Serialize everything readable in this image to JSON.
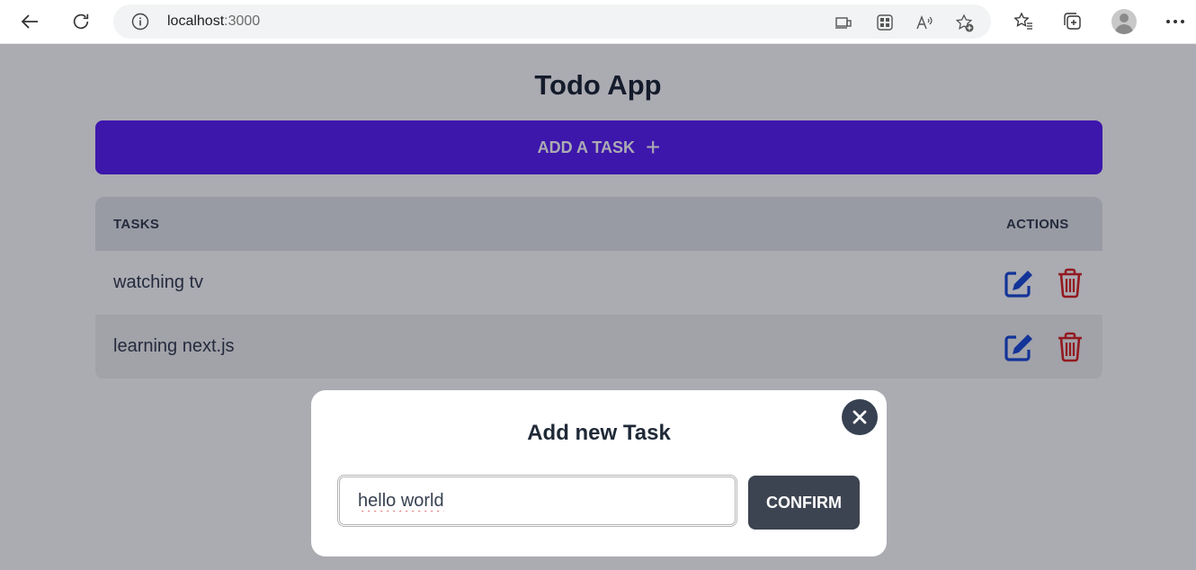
{
  "browser": {
    "url_host": "localhost",
    "url_port": ":3000",
    "icons": [
      "back-icon",
      "refresh-icon",
      "info-icon",
      "device-icon",
      "apps-icon",
      "read-aloud-icon",
      "add-favorite-icon",
      "favorites-icon",
      "collections-icon",
      "profile-icon",
      "more-icon"
    ]
  },
  "app": {
    "title": "Todo App",
    "add_button_label": "ADD A TASK",
    "add_button_plus": "+"
  },
  "table": {
    "headers": {
      "tasks": "TASKS",
      "actions": "ACTIONS"
    },
    "rows": [
      {
        "task": "watching tv"
      },
      {
        "task": "learning next.js"
      }
    ]
  },
  "modal": {
    "title": "Add new Task",
    "input_value": "hello world",
    "confirm_label": "CONFIRM",
    "close_symbol": "✕"
  },
  "colors": {
    "accent": "#5b21f6",
    "edit": "#1d4ed8",
    "delete": "#dc2626",
    "dark_button": "#3d4451"
  }
}
